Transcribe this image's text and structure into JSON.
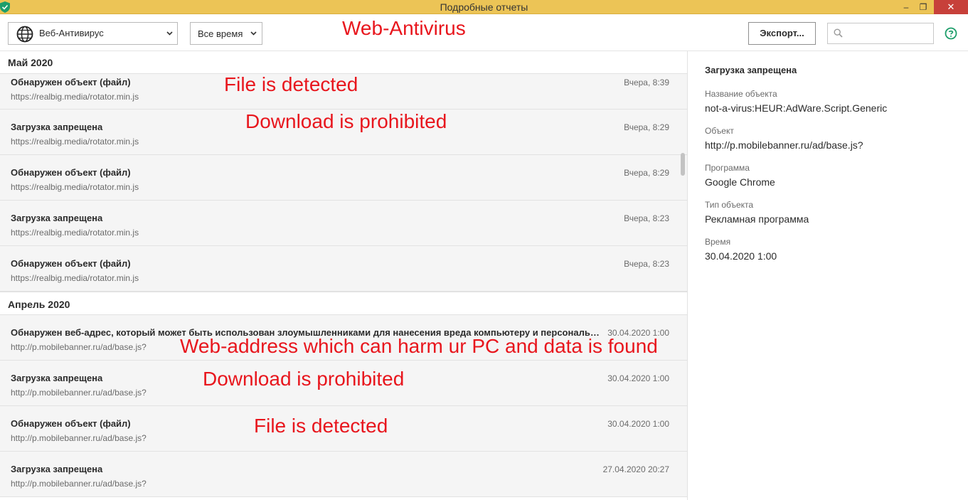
{
  "window": {
    "title": "Подробные отчеты",
    "minimize": "–",
    "maximize": "❐",
    "close": "✕"
  },
  "toolbar": {
    "component_select": {
      "value": "Веб-Антивирус",
      "icon": "globe-icon"
    },
    "period_select": {
      "value": "Все время"
    },
    "export_label": "Экспорт...",
    "search_placeholder": "",
    "help_icon": "help-icon"
  },
  "annotations": {
    "web_antivirus": "Web-Antivirus",
    "file_detected_1": "File is detected",
    "download_prohibited_1": "Download is prohibited",
    "web_address": "Web-address which can harm ur PC and data is found",
    "download_prohibited_2": "Download is prohibited",
    "file_detected_2": "File is detected",
    "color": "#e8161d"
  },
  "groups": [
    {
      "label": "Май 2020",
      "rows": [
        {
          "title": "Обнаружен объект (файл)",
          "url": "https://realbig.media/rotator.min.js",
          "time": "Вчера, 8:39"
        },
        {
          "title": "Загрузка запрещена",
          "url": "https://realbig.media/rotator.min.js",
          "time": "Вчера, 8:29"
        },
        {
          "title": "Обнаружен объект (файл)",
          "url": "https://realbig.media/rotator.min.js",
          "time": "Вчера, 8:29"
        },
        {
          "title": "Загрузка запрещена",
          "url": "https://realbig.media/rotator.min.js",
          "time": "Вчера, 8:23"
        },
        {
          "title": "Обнаружен объект (файл)",
          "url": "https://realbig.media/rotator.min.js",
          "time": "Вчера, 8:23"
        }
      ]
    },
    {
      "label": "Апрель 2020",
      "rows": [
        {
          "title": "Обнаружен веб-адрес, который может быть использован злоумышленниками для нанесения вреда компьютеру и персональным данным",
          "url": "http://p.mobilebanner.ru/ad/base.js?",
          "time": "30.04.2020 1:00"
        },
        {
          "title": "Загрузка запрещена",
          "url": "http://p.mobilebanner.ru/ad/base.js?",
          "time": "30.04.2020 1:00"
        },
        {
          "title": "Обнаружен объект (файл)",
          "url": "http://p.mobilebanner.ru/ad/base.js?",
          "time": "30.04.2020 1:00"
        },
        {
          "title": "Загрузка запрещена",
          "url": "http://p.mobilebanner.ru/ad/base.js?",
          "time": "27.04.2020 20:27"
        }
      ]
    }
  ],
  "details": {
    "title": "Загрузка запрещена",
    "fields": [
      {
        "label": "Название объекта",
        "value": "not-a-virus:HEUR:AdWare.Script.Generic"
      },
      {
        "label": "Объект",
        "value": "http://p.mobilebanner.ru/ad/base.js?"
      },
      {
        "label": "Программа",
        "value": "Google Chrome"
      },
      {
        "label": "Тип объекта",
        "value": "Рекламная программа"
      },
      {
        "label": "Время",
        "value": "30.04.2020 1:00"
      }
    ]
  }
}
